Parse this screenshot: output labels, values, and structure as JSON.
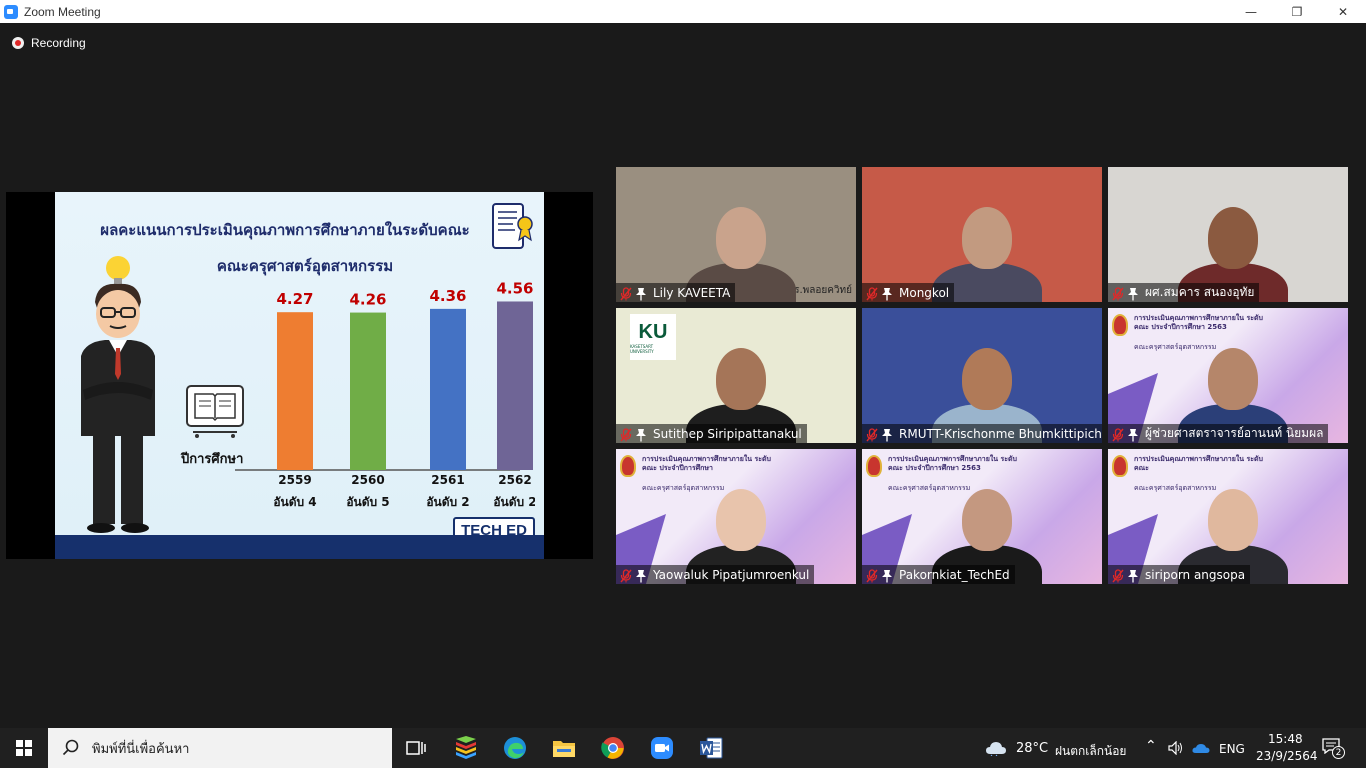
{
  "window": {
    "title": "Zoom Meeting"
  },
  "title_controls": {
    "minimize": "—",
    "restore": "❐",
    "close": "✕"
  },
  "recording": {
    "label": "Recording"
  },
  "slide": {
    "title_line1": "ผลคะแนนการประเมินคุณภาพการศึกษาภายในระดับคณะ",
    "title_line2": "คณะครุศาสตร์อุตสาหกรรม",
    "year_caption": "ปีการศึกษา",
    "badge": "TECH ED"
  },
  "chart_data": {
    "type": "bar",
    "title": "ผลคะแนนการประเมินคุณภาพการศึกษาภายในระดับคณะ",
    "xlabel": "ปีการศึกษา",
    "categories": [
      "2559",
      "2560",
      "2561",
      "2562"
    ],
    "values": [
      4.27,
      4.26,
      4.36,
      4.56
    ],
    "ranks": [
      "อันดับ 4",
      "อันดับ 5",
      "อันดับ 2",
      "อันดับ 2"
    ],
    "colors": [
      "#ee7d31",
      "#70ad47",
      "#4472c4",
      "#6f6596"
    ],
    "value_label_color": "#c00000"
  },
  "participants": [
    {
      "name": "Lily KAVEETA",
      "bg": "#9a8f80",
      "skin": "#c9a38c",
      "shirt": "#5a4b45",
      "watermark": "ร.พลอยควิทย์"
    },
    {
      "name": "Mongkol",
      "bg": "#c65a48",
      "skin": "#c29a80",
      "shirt": "#4a4a60"
    },
    {
      "name": "ผศ.สมคาร  สนองอุทัย",
      "bg": "#d8d6d2",
      "skin": "#8b5a40",
      "shirt": "#6e2a2a"
    },
    {
      "name": "Sutithep Siripipattanakul",
      "bg": "#e9ead4",
      "skin": "#a57558",
      "shirt": "#1e1e1e",
      "logo": "KU",
      "logo_sub": "KASETSART UNIVERSITY"
    },
    {
      "name": "RMUTT-Krischonme Bhumkittipich",
      "bg": "#3a4f9a",
      "skin": "#b07a58",
      "shirt": "#9ab4cc"
    },
    {
      "name": "ผู้ช่วยศาสตราจารย์อานนท์ นิยมผล",
      "bg": "#d7c4ea",
      "skin": "#b5866a",
      "shirt": "#2b3f78",
      "slide_text": "การประเมินคุณภาพการศึกษาภายใน ระดับคณะ ประจำปีการศึกษา 2563",
      "slide_sub": "คณะครุศาสตร์อุตสาหกรรม"
    },
    {
      "name": "Yaowaluk Pipatjumroenkul",
      "bg": "#dcc8ee",
      "skin": "#e8c4ac",
      "shirt": "#222222",
      "slide_text": "การประเมินคุณภาพการศึกษาภายใน ระดับคณะ ประจำปีการศึกษา",
      "slide_sub": "คณะครุศาสตร์อุตสาหกรรม"
    },
    {
      "name": "Pakornkiat_TechEd",
      "bg": "#dbc5ec",
      "skin": "#c49880",
      "shirt": "#1a1a1a",
      "slide_text": "การประเมินคุณภาพการศึกษาภายใน ระดับคณะ ประจำปีการศึกษา 2563",
      "slide_sub": "คณะครุศาสตร์อุตสาหกรรม"
    },
    {
      "name": "siriporn angsopa",
      "bg": "#d9c6ea",
      "skin": "#e0b89e",
      "shirt": "#2a2a30",
      "slide_text": "การประเมินคุณภาพการศึกษาภายใน ระดับคณะ",
      "slide_sub": "คณะครุศาสตร์อุตสาหกรรม"
    }
  ],
  "taskbar": {
    "search_placeholder": "พิมพ์ที่นี่เพื่อค้นหา",
    "weather_temp": "28°C",
    "weather_desc": "ฝนตกเล็กน้อย",
    "language": "ENG",
    "time": "15:48",
    "date": "23/9/2564",
    "notifications": "2"
  }
}
